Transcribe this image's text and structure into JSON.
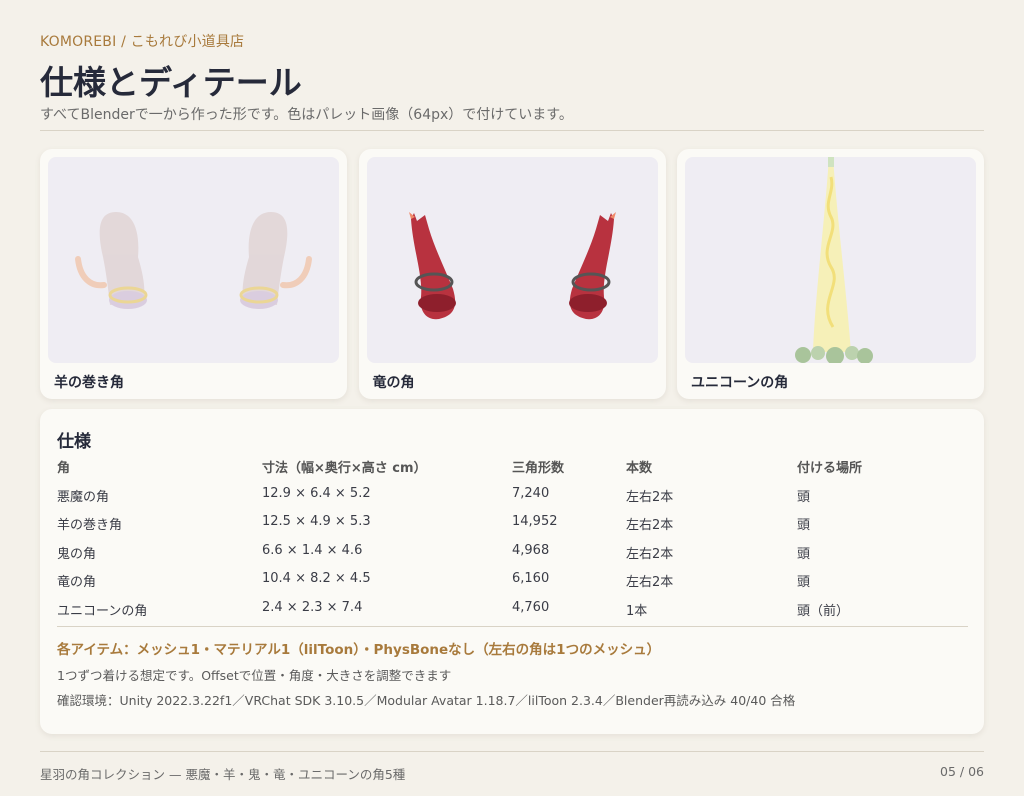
{
  "header": {
    "brand": "KOMOREBI / こもれび小道具店",
    "title": "仕様とディテール",
    "subtitle": "すべてBlenderで一から作った形です。色はパレット画像（64px）で付けています。"
  },
  "cards": [
    {
      "label": "羊の巻き角",
      "image": "ram-horns-render"
    },
    {
      "label": "竜の角",
      "image": "dragon-horns-render"
    },
    {
      "label": "ユニコーンの角",
      "image": "unicorn-horn-render"
    }
  ],
  "spec": {
    "title": "仕様",
    "headers": [
      "角",
      "寸法（幅×奥行×高さ cm）",
      "三角形数",
      "本数",
      "付ける場所"
    ],
    "rows": [
      [
        "悪魔の角",
        "12.9 × 6.4 × 5.2",
        "7,240",
        "左右2本",
        "頭"
      ],
      [
        "羊の巻き角",
        "12.5 × 4.9 × 5.3",
        "14,952",
        "左右2本",
        "頭"
      ],
      [
        "鬼の角",
        "6.6 × 1.4 × 4.6",
        "4,968",
        "左右2本",
        "頭"
      ],
      [
        "竜の角",
        "10.4 × 8.2 × 4.5",
        "6,160",
        "左右2本",
        "頭"
      ],
      [
        "ユニコーンの角",
        "2.4 × 2.3 × 7.4",
        "4,760",
        "1本",
        "頭（前）"
      ]
    ],
    "note_main": "各アイテム：メッシュ1・マテリアル1（lilToon）・PhysBoneなし（左右の角は1つのメッシュ）",
    "note_1": "1つずつ着ける想定です。Offsetで位置・角度・大きさを調整できます",
    "note_2": "確認環境：Unity 2022.3.22f1／VRChat SDK 3.10.5／Modular Avatar 1.18.7／lilToon 2.3.4／Blender再読み込み 40/40 合格"
  },
  "footer": {
    "left": "星羽の角コレクション — 悪魔・羊・鬼・竜・ユニコーンの角5種",
    "right": "05 / 06"
  },
  "colors": {
    "background": "#f4f1ea",
    "accent": "#a87a3c",
    "card_bg": "#fbfaf6",
    "image_bg": "#efedf3",
    "dragon_red": "#b8323f",
    "unicorn_yellow": "#f6f0b8"
  }
}
